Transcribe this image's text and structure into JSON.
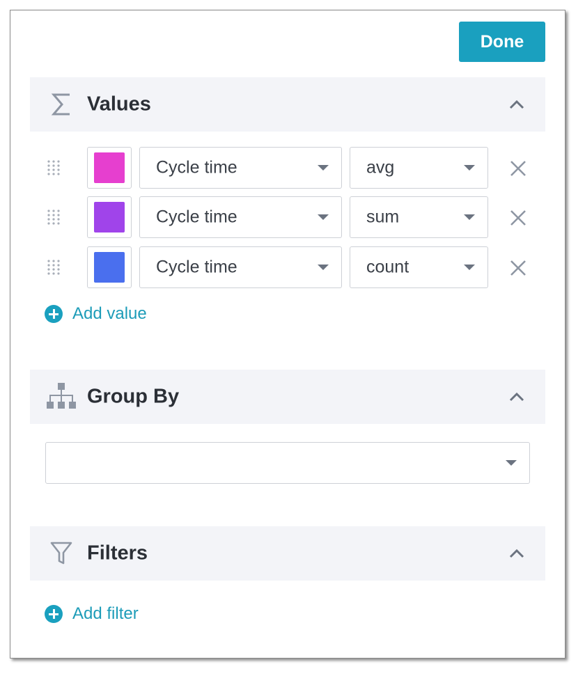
{
  "toolbar": {
    "done_label": "Done"
  },
  "colors": {
    "accent": "#1aa0bf",
    "header_bg": "#f3f4f8",
    "icon_gray": "#8e96a3"
  },
  "values_section": {
    "title": "Values",
    "icon": "sigma-icon",
    "rows": [
      {
        "swatch_color": "#e63fcf",
        "field": "Cycle time",
        "aggregation": "avg"
      },
      {
        "swatch_color": "#a044ea",
        "field": "Cycle time",
        "aggregation": "sum"
      },
      {
        "swatch_color": "#4a6fee",
        "field": "Cycle time",
        "aggregation": "count"
      }
    ],
    "add_label": "Add value"
  },
  "group_by_section": {
    "title": "Group By",
    "icon": "hierarchy-icon",
    "selected": ""
  },
  "filters_section": {
    "title": "Filters",
    "icon": "funnel-icon",
    "add_label": "Add filter"
  }
}
